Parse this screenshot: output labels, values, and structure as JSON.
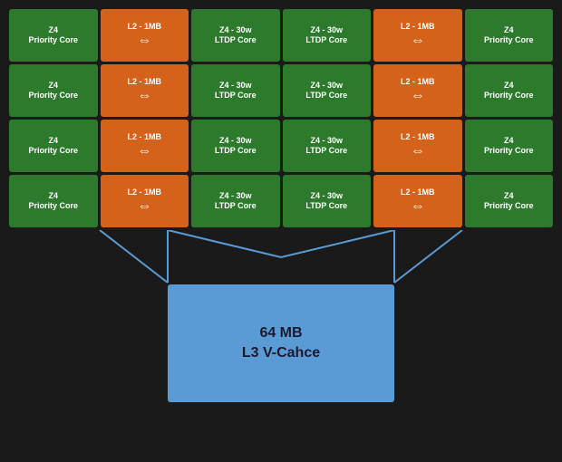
{
  "colors": {
    "green": "#2d7a2d",
    "orange": "#d4621a",
    "blue": "#5b9bd5",
    "background": "#1a1a1a"
  },
  "grid": {
    "rows": 4,
    "cols": 6,
    "cells": [
      [
        "priority_core",
        "l2_1mb",
        "ltdp_core",
        "ltdp_core",
        "l2_1mb",
        "priority_core"
      ],
      [
        "priority_core",
        "l2_1mb",
        "ltdp_core",
        "ltdp_core",
        "l2_1mb",
        "priority_core"
      ],
      [
        "priority_core",
        "l2_1mb",
        "ltdp_core",
        "ltdp_core",
        "l2_1mb",
        "priority_core"
      ],
      [
        "priority_core",
        "l2_1mb",
        "ltdp_core",
        "ltdp_core",
        "l2_1mb",
        "priority_core"
      ]
    ]
  },
  "cell_types": {
    "priority_core": {
      "line1": "Z4",
      "line2": "Priority Core",
      "type": "green",
      "has_arrow": false
    },
    "l2_1mb": {
      "line1": "L2 - 1MB",
      "line2": "",
      "type": "orange",
      "has_arrow": true
    },
    "ltdp_core": {
      "line1": "Z4 - 30w",
      "line2": "LTDP Core",
      "type": "green",
      "has_arrow": false
    }
  },
  "l3_cache": {
    "line1": "64 MB",
    "line2": "L3 V-Cahce"
  }
}
